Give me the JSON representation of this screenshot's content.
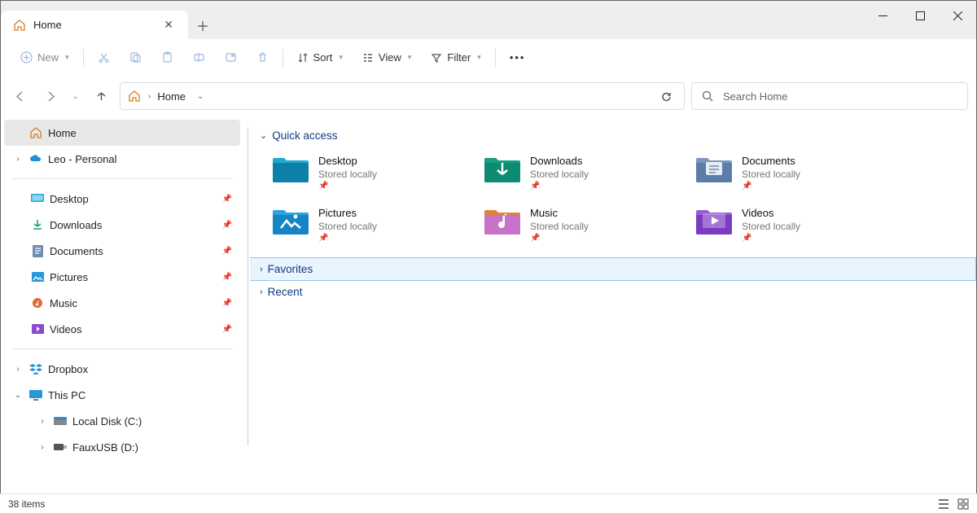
{
  "tab": {
    "title": "Home"
  },
  "toolbar": {
    "new": "New",
    "sort": "Sort",
    "view": "View",
    "filter": "Filter"
  },
  "address": {
    "location": "Home"
  },
  "search": {
    "placeholder": "Search Home"
  },
  "sidebar": {
    "home": "Home",
    "onedrive": "Leo - Personal",
    "pinned": [
      {
        "label": "Desktop"
      },
      {
        "label": "Downloads"
      },
      {
        "label": "Documents"
      },
      {
        "label": "Pictures"
      },
      {
        "label": "Music"
      },
      {
        "label": "Videos"
      }
    ],
    "dropbox": "Dropbox",
    "thispc": "This PC",
    "drives": [
      {
        "label": "Local Disk (C:)"
      },
      {
        "label": "FauxUSB (D:)"
      }
    ]
  },
  "sections": {
    "quick_access": "Quick access",
    "favorites": "Favorites",
    "recent": "Recent"
  },
  "quick_access": [
    {
      "name": "Desktop",
      "sub": "Stored locally",
      "color1": "#22a7d0",
      "color2": "#0e7fa8"
    },
    {
      "name": "Downloads",
      "sub": "Stored locally",
      "color1": "#14a085",
      "color2": "#0c8b70"
    },
    {
      "name": "Documents",
      "sub": "Stored locally",
      "color1": "#7b98bf",
      "color2": "#5c7da9"
    },
    {
      "name": "Pictures",
      "sub": "Stored locally",
      "color1": "#2aa5e0",
      "color2": "#1585c4"
    },
    {
      "name": "Music",
      "sub": "Stored locally",
      "color1": "#e0803b",
      "color2": "#c573c8"
    },
    {
      "name": "Videos",
      "sub": "Stored locally",
      "color1": "#9b5add",
      "color2": "#7b3cc2"
    }
  ],
  "status": {
    "count": "38 items"
  }
}
